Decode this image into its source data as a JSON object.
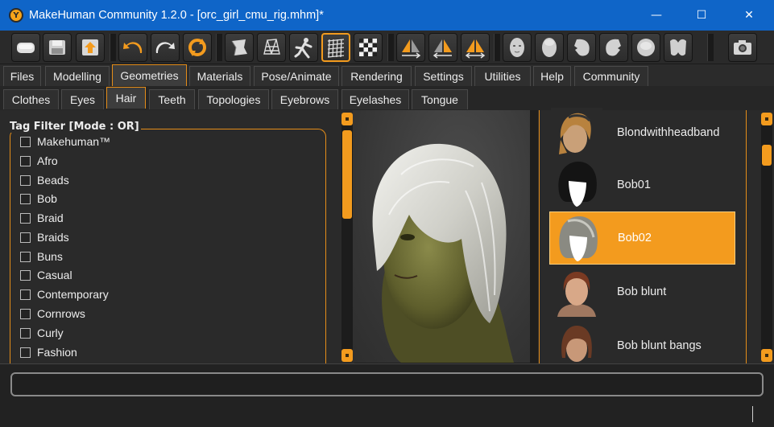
{
  "window": {
    "title": "MakeHuman Community 1.2.0 - [orc_girl_cmu_rig.mhm]*",
    "minimize": "—",
    "maximize": "☐",
    "close": "✕"
  },
  "toolbar": {
    "buttons": [
      {
        "name": "load",
        "icon": "load-icon"
      },
      {
        "name": "save",
        "icon": "save-icon"
      },
      {
        "name": "export",
        "icon": "export-icon"
      },
      {
        "name": "undo",
        "icon": "undo-icon"
      },
      {
        "name": "redo",
        "icon": "redo-icon"
      },
      {
        "name": "reset",
        "icon": "reset-icon"
      },
      {
        "name": "smooth",
        "icon": "smooth-icon"
      },
      {
        "name": "wireframe",
        "icon": "wireframe-icon"
      },
      {
        "name": "pose",
        "icon": "pose-icon"
      },
      {
        "name": "grid",
        "icon": "grid-icon"
      },
      {
        "name": "checker",
        "icon": "checker-icon"
      },
      {
        "name": "symmetry-right",
        "icon": "symmetry-right-icon"
      },
      {
        "name": "symmetry-left",
        "icon": "symmetry-left-icon"
      },
      {
        "name": "symmetry",
        "icon": "symmetry-icon"
      },
      {
        "name": "front-view",
        "icon": "front-view-icon"
      },
      {
        "name": "back-view",
        "icon": "back-view-icon"
      },
      {
        "name": "left-view",
        "icon": "left-view-icon"
      },
      {
        "name": "right-view",
        "icon": "right-view-icon"
      },
      {
        "name": "top-view",
        "icon": "top-view-icon"
      },
      {
        "name": "bottom-view",
        "icon": "bottom-view-icon"
      },
      {
        "name": "screenshot",
        "icon": "camera-icon"
      }
    ]
  },
  "main_tabs": [
    "Files",
    "Modelling",
    "Geometries",
    "Materials",
    "Pose/Animate",
    "Rendering",
    "Settings",
    "Utilities",
    "Help",
    "Community"
  ],
  "main_tab_active": "Geometries",
  "sub_tabs": [
    "Clothes",
    "Eyes",
    "Hair",
    "Teeth",
    "Topologies",
    "Eyebrows",
    "Eyelashes",
    "Tongue"
  ],
  "sub_tab_active": "Hair",
  "tag_filter": {
    "title": "Tag Filter [Mode : OR]",
    "tags": [
      "Makehuman™",
      "Afro",
      "Beads",
      "Bob",
      "Braid",
      "Braids",
      "Buns",
      "Casual",
      "Contemporary",
      "Cornrows",
      "Curly",
      "Fashion"
    ]
  },
  "hair_list": {
    "items": [
      "Blondwithheadband",
      "Bob01",
      "Bob02",
      "Bob blunt",
      "Bob blunt bangs"
    ],
    "selected": "Bob02"
  },
  "colors": {
    "accent": "#f39b1e",
    "titlebar": "#0f65c8",
    "background": "#2a2a2a"
  }
}
